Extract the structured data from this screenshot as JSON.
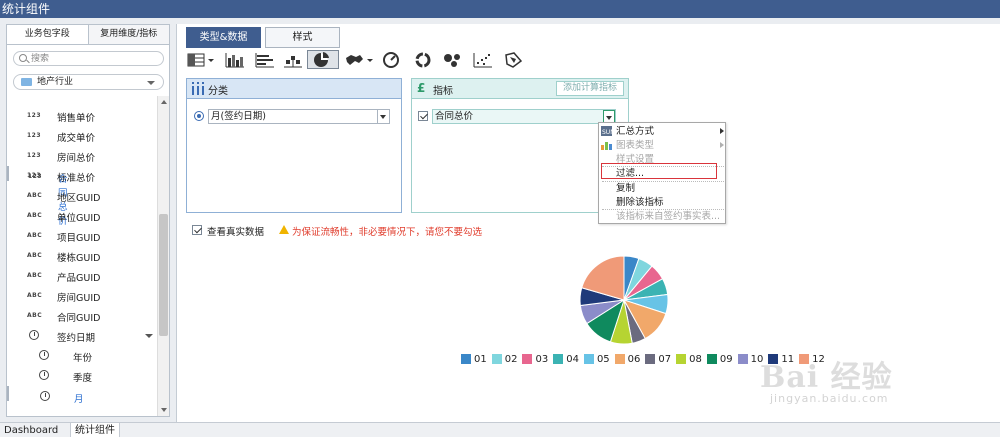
{
  "window": {
    "title": "统计组件"
  },
  "left_panel": {
    "tabs": [
      {
        "label": "业务包字段"
      },
      {
        "label": "复用维度/指标"
      }
    ],
    "search": {
      "placeholder": "搜索"
    },
    "package": {
      "label": "地产行业"
    },
    "fields": [
      {
        "type": "123",
        "label": "销售单价"
      },
      {
        "type": "123",
        "label": "成交单价"
      },
      {
        "type": "123",
        "label": "房间总价"
      },
      {
        "type": "123",
        "label": "合同总价",
        "selected": true
      },
      {
        "type": "123",
        "label": "标准总价"
      },
      {
        "type": "ABC",
        "label": "地区GUID"
      },
      {
        "type": "ABC",
        "label": "单位GUID"
      },
      {
        "type": "ABC",
        "label": "项目GUID"
      },
      {
        "type": "ABC",
        "label": "楼栋GUID"
      },
      {
        "type": "ABC",
        "label": "产品GUID"
      },
      {
        "type": "ABC",
        "label": "房间GUID"
      },
      {
        "type": "ABC",
        "label": "合同GUID"
      }
    ],
    "date_field": {
      "label": "签约日期"
    },
    "date_subs": [
      {
        "label": "年份"
      },
      {
        "label": "季度"
      },
      {
        "label": "月"
      }
    ]
  },
  "main_tabs": [
    {
      "label": "类型&数据"
    },
    {
      "label": "样式"
    }
  ],
  "category_box": {
    "title": "分类",
    "value": "月(签约日期)"
  },
  "measure_box": {
    "title": "指标",
    "add_button": "添加计算指标",
    "value": "合同总价"
  },
  "context_menu": {
    "items": [
      {
        "label": "汇总方式",
        "disabled": false,
        "submenu": true
      },
      {
        "label": "图表类型",
        "disabled": true,
        "submenu": true
      },
      {
        "label": "样式设置",
        "disabled": true
      },
      {
        "label": "过滤...",
        "disabled": false
      },
      {
        "label": "复制",
        "disabled": false
      },
      {
        "label": "删除该指标",
        "disabled": false
      },
      {
        "label": "该指标来自签约事实表...",
        "disabled": true
      }
    ]
  },
  "real_data": {
    "label": "查看真实数据",
    "warning": "为保证流畅性，非必要情况下，请您不要勾选"
  },
  "chart_data": {
    "type": "pie",
    "categories": [
      "01",
      "02",
      "03",
      "04",
      "05",
      "06",
      "07",
      "08",
      "09",
      "10",
      "11",
      "12"
    ],
    "values": [
      5.5,
      5.5,
      6,
      6,
      7,
      12,
      5,
      8,
      11,
      7,
      6.5,
      20.5
    ],
    "colors": [
      "#3a87c8",
      "#7fd6de",
      "#e8668f",
      "#3bb3b3",
      "#67c3e6",
      "#f1a86a",
      "#6b6b7f",
      "#b6d432",
      "#0f8a5e",
      "#8b8cc9",
      "#1f3a7a",
      "#f09a78"
    ],
    "legend": "bottom"
  },
  "bottom_tabs": [
    {
      "label": "Dashboard"
    },
    {
      "label": "统计组件"
    }
  ],
  "watermark": {
    "text": "Bai 经验",
    "sub": "jingyan.baidu.com"
  }
}
